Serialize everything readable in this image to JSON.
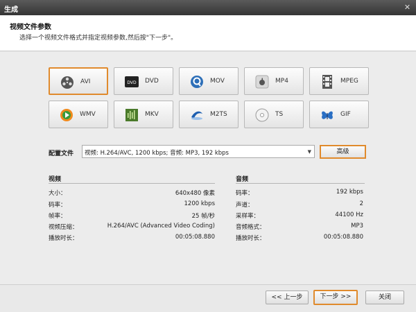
{
  "window": {
    "title": "生成",
    "close_glyph": "✕"
  },
  "header": {
    "title": "视频文件参数",
    "subtitle": "选择一个视频文件格式并指定视频参数,然后按\"下一步\"。"
  },
  "formats": [
    {
      "label": "AVI",
      "icon": "film-reel-icon",
      "selected": true
    },
    {
      "label": "DVD",
      "icon": "dvd-icon",
      "selected": false
    },
    {
      "label": "MOV",
      "icon": "quicktime-icon",
      "selected": false
    },
    {
      "label": "MP4",
      "icon": "apple-icon",
      "selected": false
    },
    {
      "label": "MPEG",
      "icon": "filmstrip-icon",
      "selected": false
    },
    {
      "label": "WMV",
      "icon": "windows-media-icon",
      "selected": false
    },
    {
      "label": "MKV",
      "icon": "mkv-icon",
      "selected": false
    },
    {
      "label": "M2TS",
      "icon": "bluray-icon",
      "selected": false
    },
    {
      "label": "TS",
      "icon": "disc-icon",
      "selected": false
    },
    {
      "label": "GIF",
      "icon": "butterfly-icon",
      "selected": false
    }
  ],
  "config": {
    "label": "配置文件",
    "value": "视频: H.264/AVC, 1200 kbps; 音频: MP3, 192 kbps",
    "advanced_label": "高级"
  },
  "video": {
    "title": "视频",
    "rows": [
      {
        "key": "大小：",
        "value": "640x480 像素"
      },
      {
        "key": "码率：",
        "value": "1200 kbps"
      },
      {
        "key": "帧率：",
        "value": "25 帧/秒"
      },
      {
        "key": "视频压缩：",
        "value": "H.264/AVC (Advanced Video Coding)"
      },
      {
        "key": "播放时长：",
        "value": "00:05:08.880"
      }
    ]
  },
  "audio": {
    "title": "音频",
    "rows": [
      {
        "key": "码率：",
        "value": "192 kbps"
      },
      {
        "key": "声道：",
        "value": "2"
      },
      {
        "key": "采样率：",
        "value": "44100 Hz"
      },
      {
        "key": "音频格式：",
        "value": "MP3"
      },
      {
        "key": "播放时长：",
        "value": "00:05:08.880"
      }
    ]
  },
  "footer": {
    "prev_label": "<< 上一步",
    "next_label": "下一步 >>",
    "close_label": "关闭"
  },
  "colors": {
    "accent": "#e08a2c",
    "titlebar": "#3f3f3f"
  }
}
